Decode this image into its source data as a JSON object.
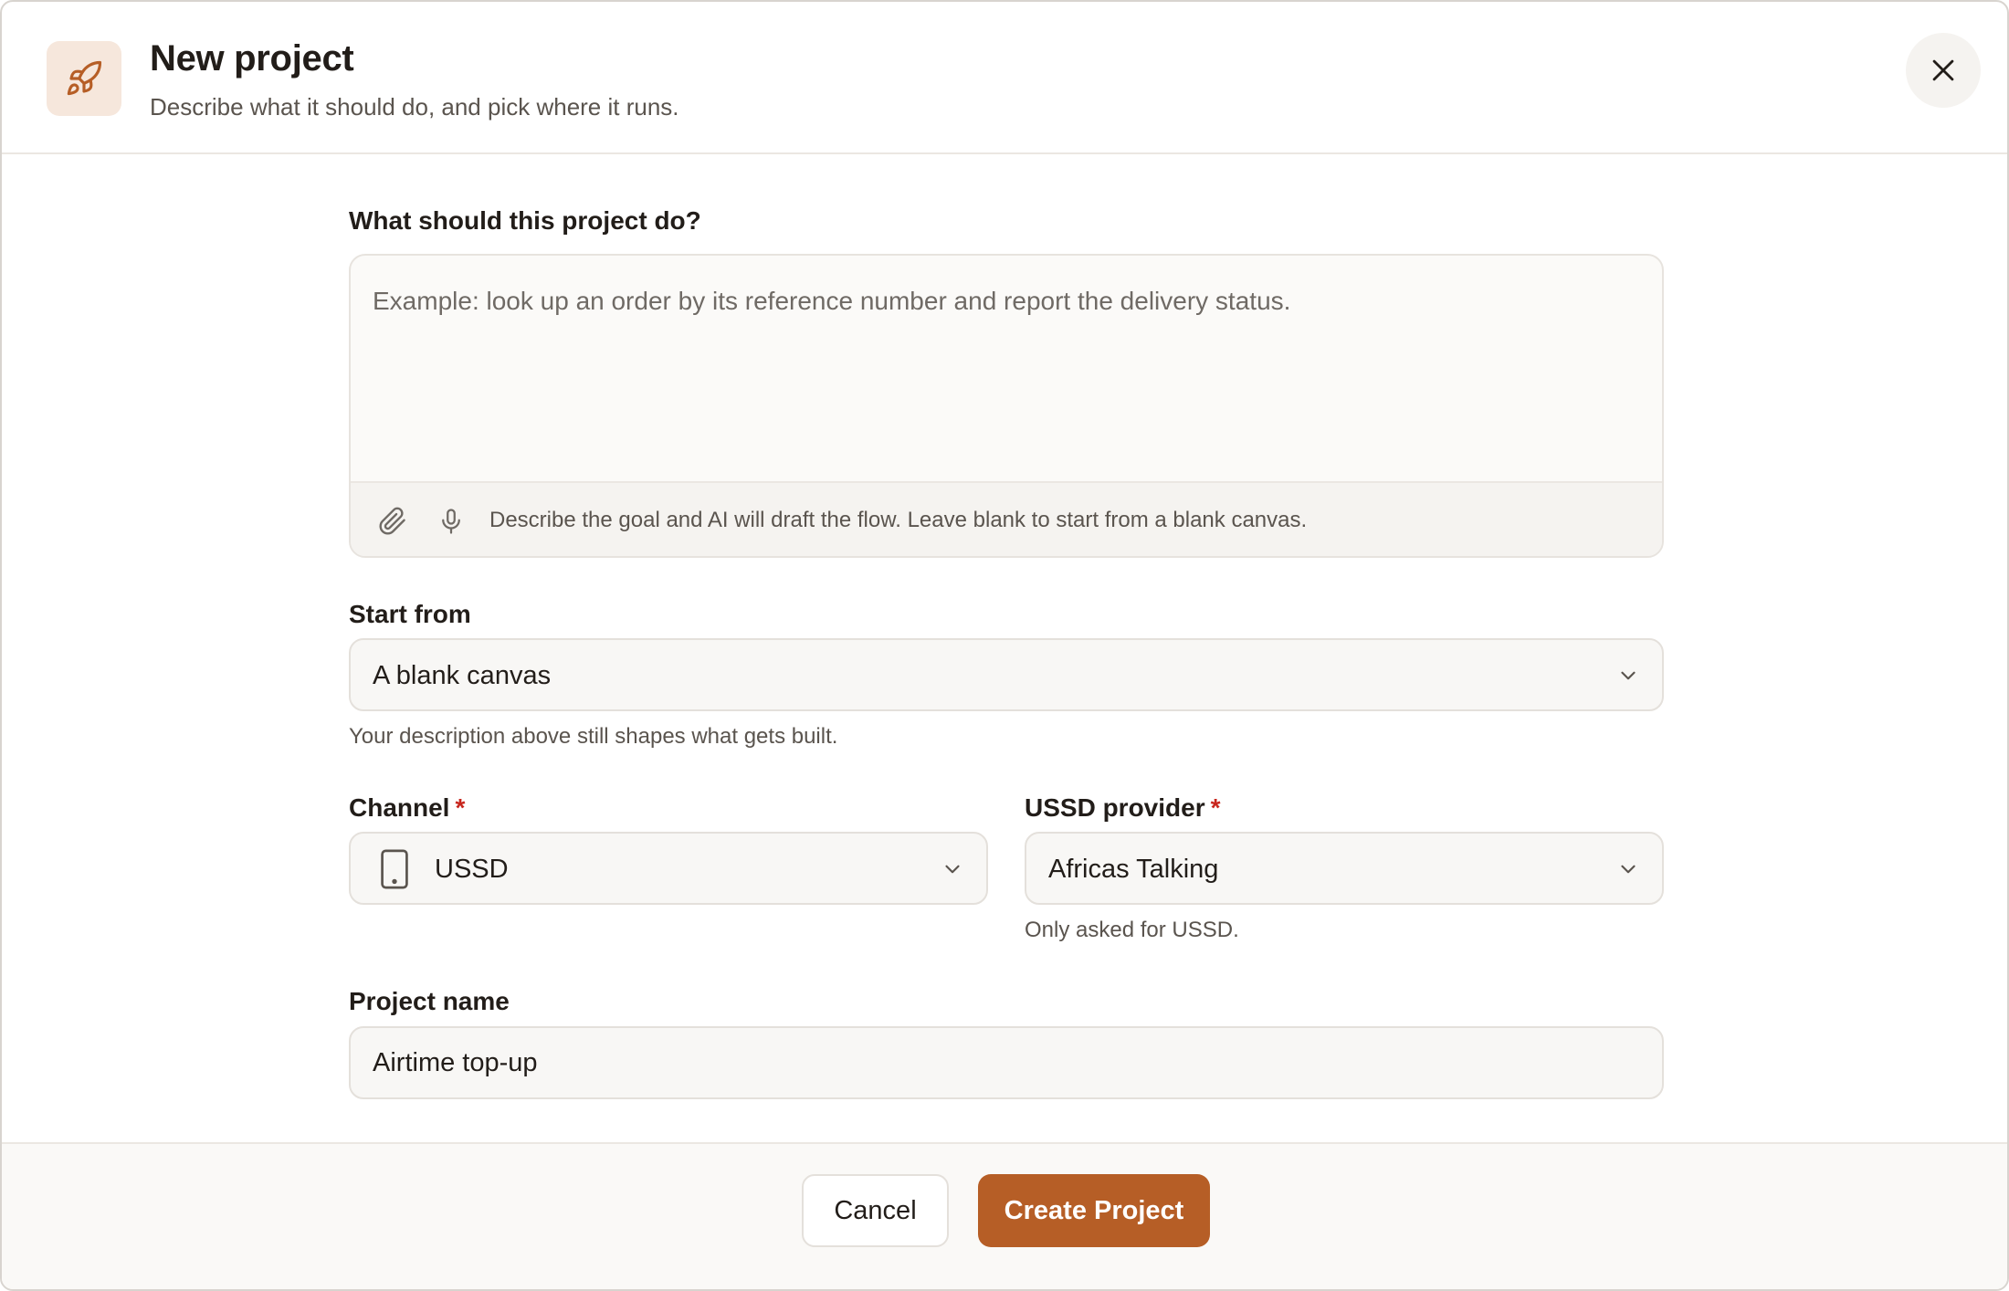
{
  "header": {
    "title": "New project",
    "subtitle": "Describe what it should do, and pick where it runs.",
    "icon": "rocket-icon"
  },
  "description": {
    "label": "What should this project do?",
    "value": "",
    "placeholder": "Example: look up an order by its reference number and report the delivery status.",
    "hint": "Describe the goal and AI will draft the flow. Leave blank to start from a blank canvas."
  },
  "start_from": {
    "label": "Start from",
    "value": "A blank canvas",
    "hint": "Your description above still shapes what gets built."
  },
  "channel": {
    "label": "Channel",
    "required_mark": "*",
    "value": "USSD",
    "icon": "phone-icon"
  },
  "provider": {
    "label": "USSD provider",
    "required_mark": "*",
    "value": "Africas Talking",
    "hint": "Only asked for USSD."
  },
  "project_name": {
    "label": "Project name",
    "value": "Airtime top-up"
  },
  "footer": {
    "cancel_label": "Cancel",
    "create_label": "Create Project"
  },
  "colors": {
    "accent": "#b65e26",
    "accent_soft": "#f6e7dc",
    "required": "#c8261d"
  }
}
